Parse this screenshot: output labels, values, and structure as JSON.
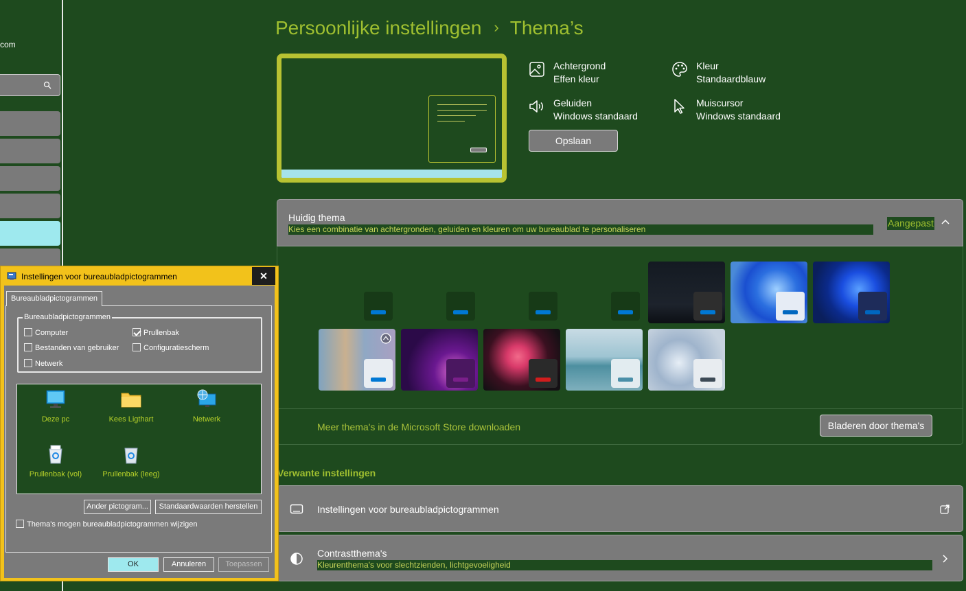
{
  "sidebar": {
    "account_email": "com",
    "search_icon": "search-icon",
    "nav_items": [
      {
        "id": "nav-1",
        "active": false
      },
      {
        "id": "nav-2",
        "active": false
      },
      {
        "id": "nav-3",
        "active": false
      },
      {
        "id": "nav-4",
        "active": false
      },
      {
        "id": "nav-personalization",
        "active": true
      },
      {
        "id": "nav-6",
        "active": false
      }
    ]
  },
  "header": {
    "parent": "Persoonlijke instellingen",
    "separator": "›",
    "current": "Thema’s"
  },
  "summary": {
    "background": {
      "label": "Achtergrond",
      "value": "Effen kleur",
      "icon": "image-icon"
    },
    "color": {
      "label": "Kleur",
      "value": "Standaardblauw",
      "icon": "palette-icon"
    },
    "sounds": {
      "label": "Geluiden",
      "value": "Windows standaard",
      "icon": "speaker-icon"
    },
    "cursor": {
      "label": "Muiscursor",
      "value": "Windows standaard",
      "icon": "cursor-icon"
    },
    "save_label": "Opslaan"
  },
  "current_theme": {
    "title": "Huidig thema",
    "subtitle": "Kies een combinatie van achtergronden, geluiden en kleuren om uw bureaublad te personaliseren",
    "value": "Aangepast",
    "themes": [
      {
        "id": "custom-1",
        "bg": "#1e4a1e",
        "chip": "#173a17",
        "bar": "#0078d4"
      },
      {
        "id": "custom-2",
        "bg": "#1e4a1e",
        "chip": "#173a17",
        "bar": "#0078d4"
      },
      {
        "id": "custom-3",
        "bg": "#1e4a1e",
        "chip": "#173a17",
        "bar": "#0078d4"
      },
      {
        "id": "custom-4",
        "bg": "#1e4a1e",
        "chip": "#173a17",
        "bar": "#0078d4"
      },
      {
        "id": "night",
        "bg": "#141a22",
        "chip": "#2e2e2e",
        "bar": "#0078d4"
      },
      {
        "id": "windows-light",
        "bg": "#4a8ad8",
        "chip": "#e6ecf5",
        "bar": "#0067c0"
      },
      {
        "id": "windows-dark",
        "bg": "#0a1f5c",
        "chip": "#1e2c5a",
        "bar": "#0067c0"
      },
      {
        "id": "spotlight",
        "bg": "#b8a68e",
        "chip": "#e8edf2",
        "bar": "#0078d4"
      },
      {
        "id": "glow",
        "bg": "#3a0f55",
        "chip": "#4a1760",
        "bar": "#7a1f8a"
      },
      {
        "id": "captured-motion",
        "bg": "#1d1a22",
        "chip": "#2a2a2a",
        "bar": "#d11d1d"
      },
      {
        "id": "sunrise",
        "bg": "#8fb8c7",
        "chip": "#e2ecf0",
        "bar": "#4a8fa8"
      },
      {
        "id": "flow",
        "bg": "#b4c2d2",
        "chip": "#e8ecf0",
        "bar": "#3d4a56"
      }
    ],
    "more_link": "Meer thema's in de Microsoft Store downloaden",
    "browse_label": "Bladeren door thema's"
  },
  "related": {
    "heading": "Verwante instellingen",
    "desktop_icons": {
      "title": "Instellingen voor bureaubladpictogrammen",
      "icon": "monitor-icon",
      "trailing": "external-link-icon"
    },
    "contrast": {
      "title": "Contrastthema's",
      "subtitle": "Kleurenthema's voor slechtzienden, lichtgevoeligheid",
      "icon": "contrast-icon",
      "trailing": "chevron-right-icon"
    }
  },
  "dialog": {
    "title": "Instellingen voor bureaubladpictogrammen",
    "close": "✕",
    "tab": "Bureaubladpictogrammen",
    "group": "Bureaubladpictogrammen",
    "checkboxes": [
      {
        "label": "Computer",
        "checked": false
      },
      {
        "label": "Prullenbak",
        "checked": true
      },
      {
        "label": "Bestanden van gebruiker",
        "checked": false
      },
      {
        "label": "Configuratiescherm",
        "checked": false
      },
      {
        "label": "Netwerk",
        "checked": false
      }
    ],
    "icons": [
      {
        "label": "Deze pc",
        "icon": "computer-icon"
      },
      {
        "label": "Kees Ligthart",
        "icon": "folder-icon"
      },
      {
        "label": "Netwerk",
        "icon": "network-icon"
      },
      {
        "label": "Prullenbak (vol)",
        "icon": "recycle-bin-full-icon"
      },
      {
        "label": "Prullenbak (leeg)",
        "icon": "recycle-bin-empty-icon"
      }
    ],
    "change_icon": "Ander pictogram...",
    "restore_default": "Standaardwaarden herstellen",
    "allow_themes": "Thema's mogen bureaubladpictogrammen wijzigen",
    "ok": "OK",
    "cancel": "Annuleren",
    "apply": "Toepassen"
  }
}
